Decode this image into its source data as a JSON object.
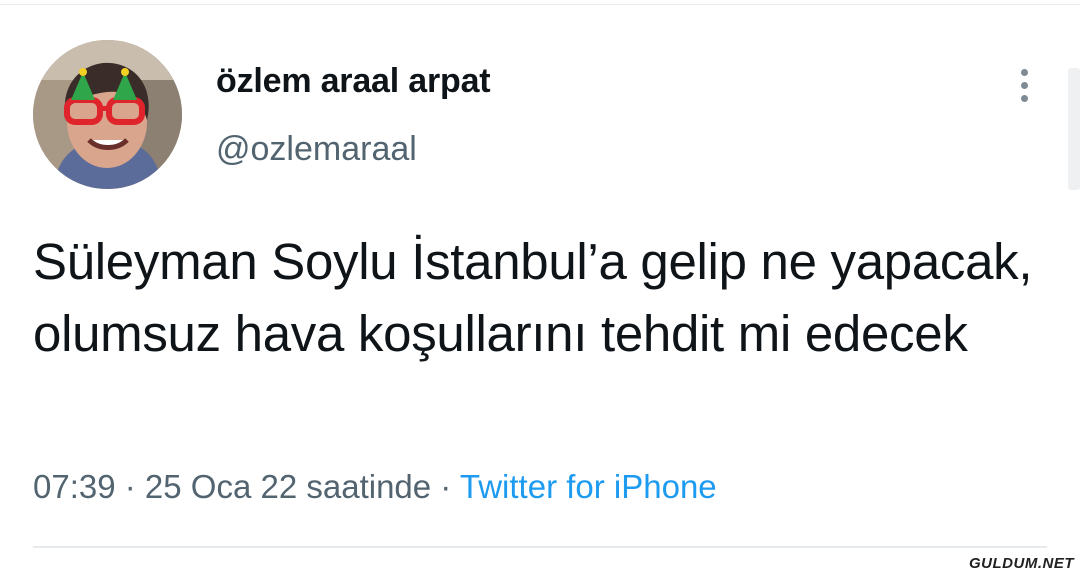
{
  "tweet": {
    "author": {
      "display_name": "özlem araal arpat",
      "handle": "@ozlemaraal"
    },
    "text": "Süleyman Soylu İstanbul’a gelip ne yapacak, olumsuz hava koşullarını tehdit mi edecek",
    "time": "07:39",
    "date": "25 Oca 22 saatinde",
    "separator": " · ",
    "source": "Twitter for iPhone"
  },
  "watermark": "GULDUM.NET",
  "colors": {
    "text": "#0f1419",
    "secondary": "#536471",
    "link": "#1d9bf0"
  }
}
